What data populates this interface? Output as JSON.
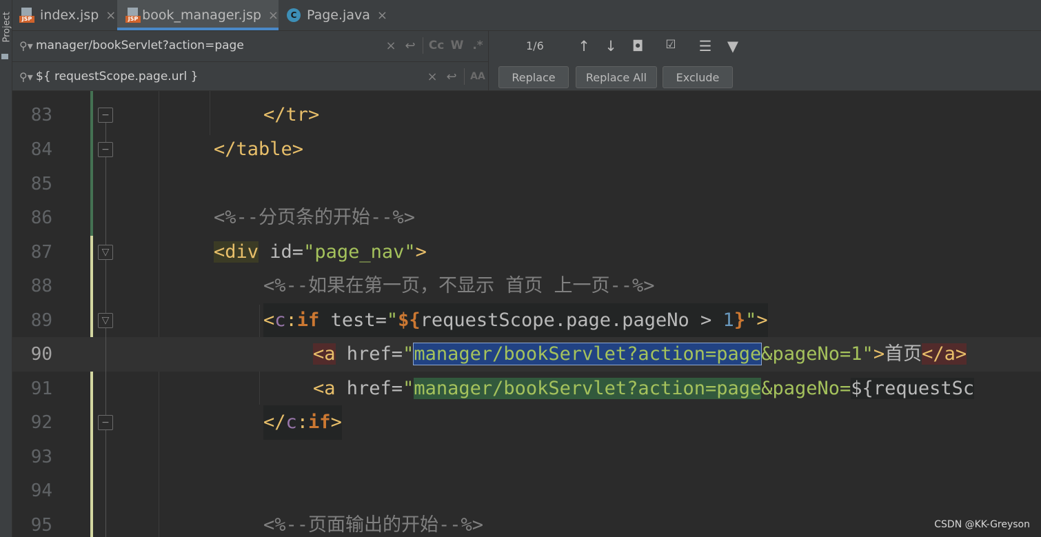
{
  "side_panel": {
    "label": "Project"
  },
  "tabs": [
    {
      "label": "index.jsp",
      "icon": "jsp-file-icon",
      "badge": "JSP"
    },
    {
      "label": "book_manager.jsp",
      "icon": "jsp-file-icon",
      "badge": "JSP"
    },
    {
      "label": "Page.java",
      "icon": "java-class-icon",
      "badge": "C"
    }
  ],
  "find": {
    "search_value": "manager/bookServlet?action=page",
    "replace_value": "${ requestScope.page.url }",
    "match_count": "1/6",
    "match_case_label": "Cc",
    "words_label": "W",
    "regex_label": ".*",
    "preserve_case_label": "AA",
    "replace_label": "Replace",
    "replace_all_label": "Replace All",
    "exclude_label": "Exclude"
  },
  "code": {
    "line83": {
      "no": "83",
      "close_tr": "</tr>"
    },
    "line84": {
      "no": "84",
      "close_table": "</table>"
    },
    "line85": {
      "no": "85"
    },
    "line86": {
      "no": "86",
      "comment": "<%--分页条的开始--%>"
    },
    "line87": {
      "no": "87",
      "tag_open": "<div",
      "attr": " id=",
      "value": "\"page_nav\"",
      "close": ">"
    },
    "line88": {
      "no": "88",
      "comment": "<%--如果在第一页，不显示 首页 上一页--%>"
    },
    "line89": {
      "no": "89",
      "lt": "<",
      "ns": "c",
      "colon": ":",
      "name": "if",
      "attr": " test=",
      "q1": "\"",
      "expr_open": "${",
      "expr_body": "requestScope.page.pageNo > ",
      "num": "1",
      "expr_close": "}",
      "q2": "\"",
      "gt": ">"
    },
    "line90": {
      "no": "90",
      "tag_open": "<a",
      "attr": " href=",
      "q": "\"",
      "match": "manager/bookServlet?action=page",
      "rest": "&pageNo=1\"",
      "gt": ">",
      "text": "首页",
      "tag_close": "</a>"
    },
    "line91": {
      "no": "91",
      "tag_open": "<a",
      "attr": " href=",
      "q": "\"",
      "match": "manager/bookServlet?action=page",
      "rest": "&pageNo=",
      "expr": "${requestSc"
    },
    "line92": {
      "no": "92",
      "lt": "</",
      "ns": "c",
      "colon": ":",
      "name": "if",
      "gt": ">"
    },
    "line93": {
      "no": "93"
    },
    "line94": {
      "no": "94"
    },
    "line95": {
      "no": "95",
      "comment": "<%--页面输出的开始--%>"
    }
  },
  "watermark": "CSDN @KK-Greyson"
}
